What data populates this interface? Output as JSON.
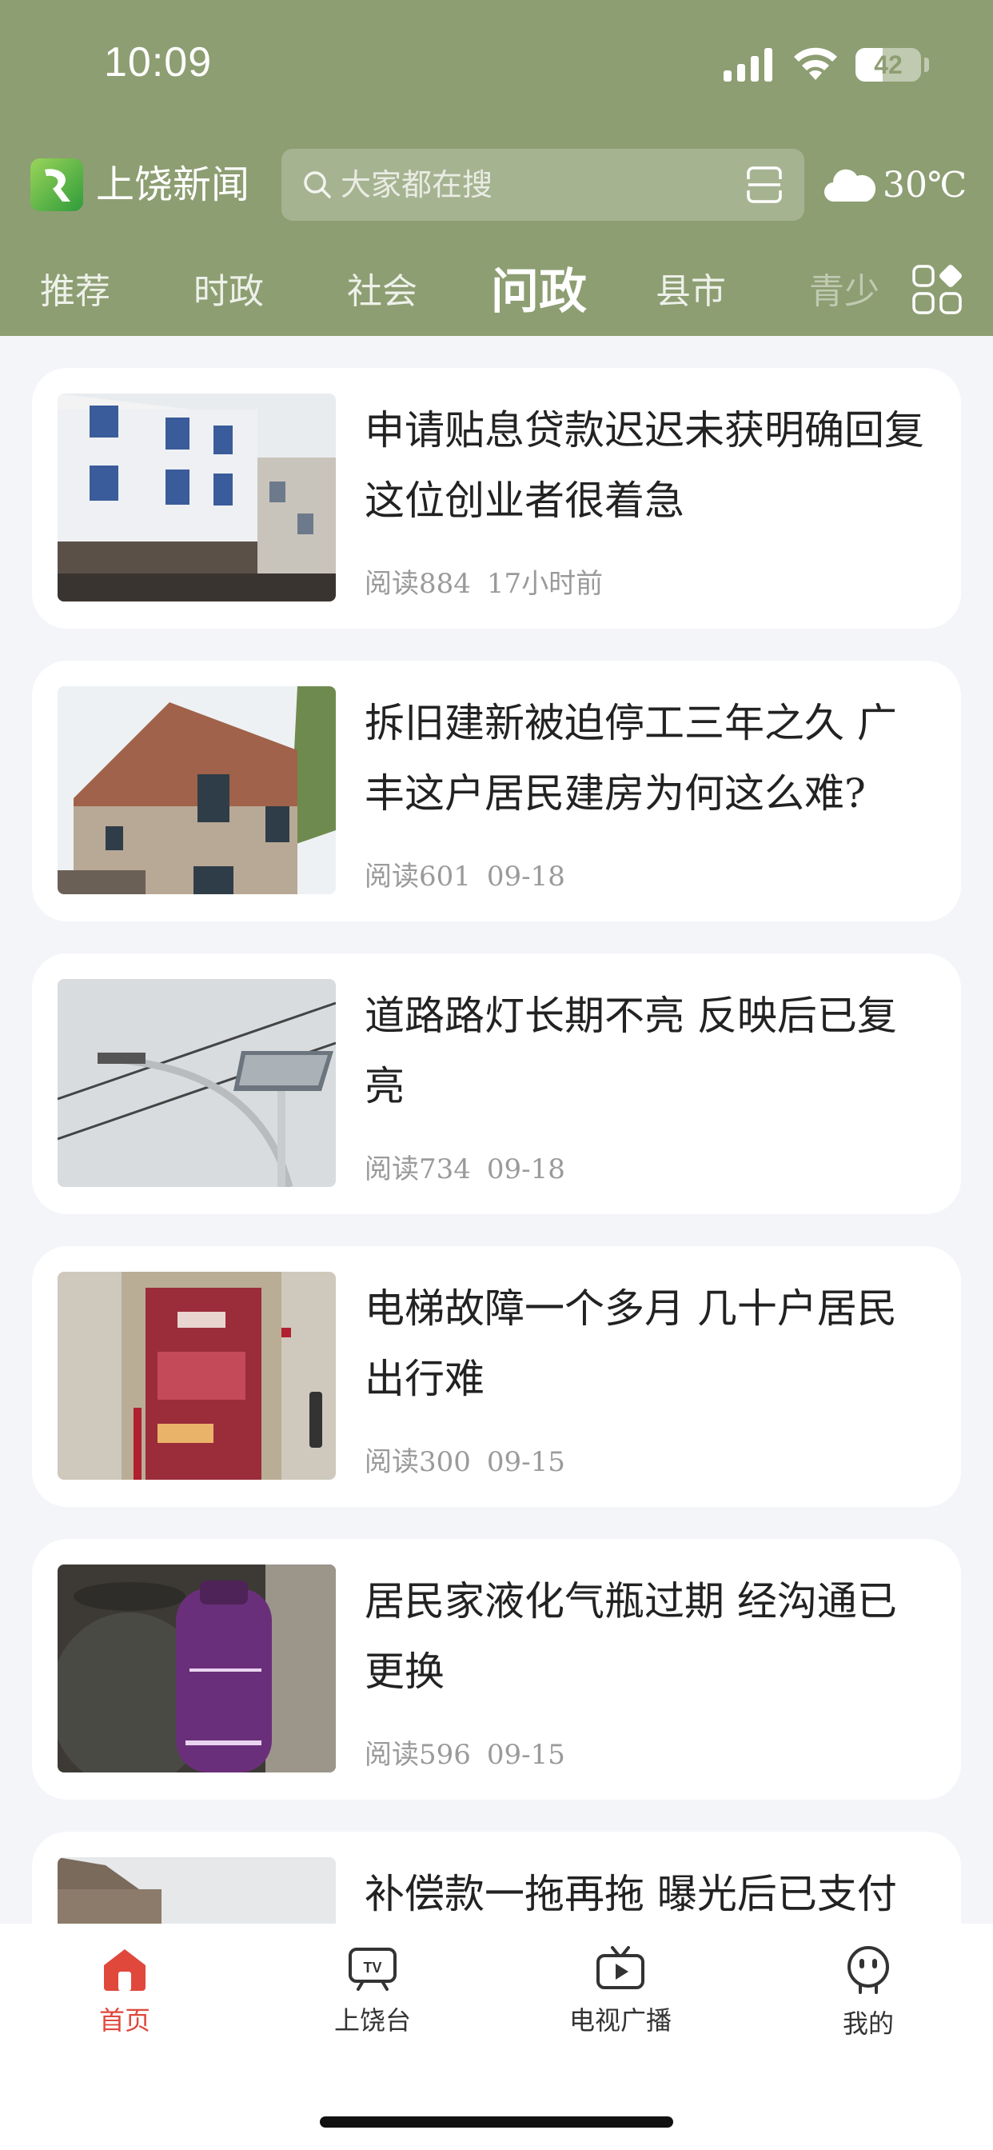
{
  "status_bar": {
    "time": "10:09",
    "battery": "42",
    "battery_level": 0.42
  },
  "header": {
    "app_name": "上饶新闻",
    "search_placeholder": "大家都在搜",
    "temperature": "30℃",
    "weather_icon": "cloud-icon"
  },
  "tabs": [
    {
      "label": "推荐"
    },
    {
      "label": "时政"
    },
    {
      "label": "社会"
    },
    {
      "label": "问政",
      "active": true
    },
    {
      "label": "县市"
    },
    {
      "label": "青少"
    }
  ],
  "articles": [
    {
      "title": "申请贴息贷款迟迟未获明确回复 这位创业者很着急",
      "reads": "阅读884",
      "time": "17小时前"
    },
    {
      "title": "拆旧建新被迫停工三年之久 广丰这户居民建房为何这么难?",
      "reads": "阅读601",
      "time": "09-18"
    },
    {
      "title": "道路路灯长期不亮 反映后已复亮",
      "reads": "阅读734",
      "time": "09-18"
    },
    {
      "title": "电梯故障一个多月 几十户居民出行难",
      "reads": "阅读300",
      "time": "09-15"
    },
    {
      "title": "居民家液化气瓶过期 经沟通已更换",
      "reads": "阅读596",
      "time": "09-15"
    },
    {
      "title": "补偿款一拖再拖 曝光后已支付",
      "reads": "",
      "time": ""
    }
  ],
  "bottom_nav": [
    {
      "label": "首页",
      "icon": "home-icon",
      "active": true
    },
    {
      "label": "上饶台",
      "icon": "tv-icon"
    },
    {
      "label": "电视广播",
      "icon": "broadcast-icon"
    },
    {
      "label": "我的",
      "icon": "profile-icon"
    }
  ],
  "colors": {
    "header_bg": "#8d9e72",
    "accent": "#e0483c",
    "background": "#f4f5f9"
  }
}
